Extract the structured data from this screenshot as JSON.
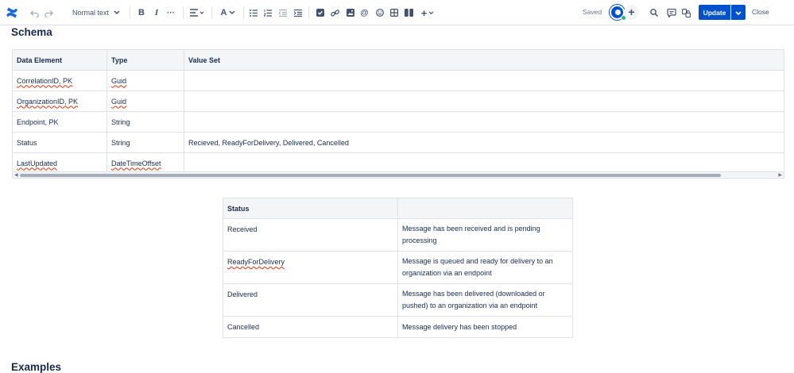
{
  "toolbar": {
    "text_style": "Normal text",
    "saved_label": "Saved",
    "update_label": "Update",
    "close_label": "Close",
    "collaborator_count": "1"
  },
  "page": {
    "heading": "Schema",
    "next_heading": "Examples"
  },
  "schema_table": {
    "headers": [
      "Data Element",
      "Type",
      "Value Set"
    ],
    "rows": [
      {
        "element": "CorrelationID, PK",
        "type": "Guid",
        "values": ""
      },
      {
        "element": "OrganizationID, PK",
        "type": "Guid",
        "values": ""
      },
      {
        "element": "Endpoint, PK",
        "type": "String",
        "values": ""
      },
      {
        "element": "Status",
        "type": "String",
        "values": "Recieved, ReadyForDelivery, Delivered, Cancelled"
      },
      {
        "element": "LastUpdated",
        "type": "DateTimeOffset",
        "values": ""
      }
    ]
  },
  "status_table": {
    "headers": [
      "Status",
      ""
    ],
    "rows": [
      {
        "status": "Received",
        "description": "Message has been received and is pending processing"
      },
      {
        "status": "ReadyForDelivery",
        "description": "Message is queued and ready for delivery to an organization via an endpoint"
      },
      {
        "status": "Delivered",
        "description": "Message has been delivered (downloaded or pushed) to an organization via an endpoint"
      },
      {
        "status": "Cancelled",
        "description": "Message delivery has been stopped"
      }
    ]
  },
  "colors": {
    "accent": "#0052cc",
    "header_bg": "#f4f5f7",
    "border": "#dfe1e6",
    "text": "#172b4d",
    "spellcheck": "#de350b"
  },
  "icons": [
    "confluence-logo-icon",
    "undo-icon",
    "redo-icon",
    "bold-icon",
    "italic-icon",
    "more-formatting-icon",
    "align-icon",
    "text-color-icon",
    "bullet-list-icon",
    "numbered-list-icon",
    "outdent-icon",
    "indent-icon",
    "action-item-icon",
    "link-icon",
    "image-icon",
    "mention-icon",
    "emoji-icon",
    "table-icon",
    "layout-icon",
    "insert-plus-icon",
    "search-icon",
    "comment-icon",
    "restrictions-icon"
  ]
}
